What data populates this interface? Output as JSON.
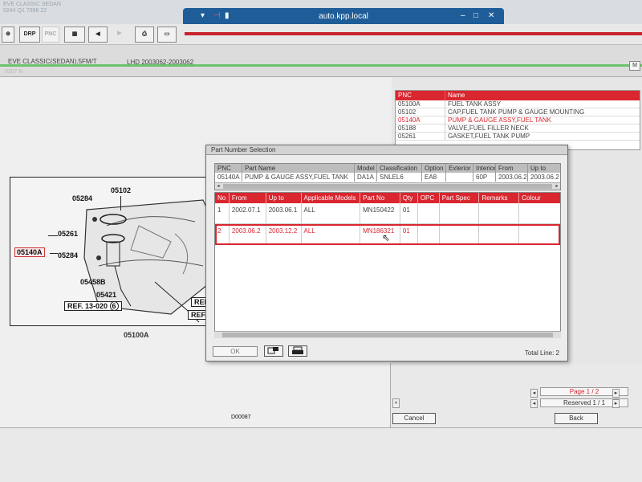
{
  "window": {
    "title": "auto.kpp.local",
    "controls": [
      "–",
      "□",
      "✕"
    ]
  },
  "topbar": {
    "ghost_text": [
      "EVE CLASSIC SEDAN",
      "0244 Q1 7998 22"
    ]
  },
  "toolbar": {
    "drp_label": "DRP",
    "pnc_label": "PNC"
  },
  "info": {
    "model": "EVE CLASSIC(SEDAN).5FM/T",
    "lhd": "LHD   2003062-2003062",
    "code": "0207 N",
    "right_box": "M"
  },
  "diagram": {
    "labels": {
      "c05102": "05102",
      "c05284a": "05284",
      "c05261": "05261",
      "c05140a": "05140A",
      "c05284b": "05284",
      "c05458b": "05458B",
      "c05421": "05421",
      "ref1": "REF. 13-020",
      "ref1_num": "6",
      "ref2": "REF",
      "ref3": "REF.",
      "c05100a": "05100A"
    },
    "figure_no": "D00087"
  },
  "pnc_list": {
    "headers": [
      "PNC",
      "Name"
    ],
    "rows": [
      {
        "pnc": "05100A",
        "name": "FUEL TANK ASSY",
        "selected": false
      },
      {
        "pnc": "05102",
        "name": "CAP,FUEL TANK PUMP & GAUGE MOUNTING",
        "selected": false
      },
      {
        "pnc": "05140A",
        "name": "PUMP & GAUGE ASSY,FUEL TANK",
        "selected": true
      },
      {
        "pnc": "05188",
        "name": "VALVE,FUEL FILLER NECK",
        "selected": false
      },
      {
        "pnc": "05261",
        "name": "GASKET,FUEL TANK PUMP",
        "selected": false
      }
    ]
  },
  "dialog": {
    "title": "Part Number Selection",
    "top_table": {
      "headers": [
        "PNC",
        "Part Name",
        "Model",
        "Classification",
        "Option",
        "Exterior",
        "Interior",
        "From",
        "Up to"
      ],
      "row": [
        "05140A",
        "PUMP & GAUGE ASSY,FUEL TANK",
        "DA1A",
        "SNLEL6",
        "EA8",
        "",
        "60P",
        "2003.06.2",
        "2003.06.2"
      ]
    },
    "main_table": {
      "headers": [
        "No",
        "From",
        "Up to",
        "Applicable Models",
        "Part No",
        "Qty",
        "OPC",
        "Part Spec",
        "Remarks",
        "Colour"
      ],
      "rows": [
        {
          "no": "1",
          "from": "2002.07.1",
          "upto": "2003.06.1",
          "models": "ALL",
          "part_no": "MN150422",
          "qty": "01",
          "opc": "",
          "spec": "",
          "remarks": "",
          "colour": ""
        },
        {
          "no": "2",
          "from": "2003.06.2",
          "upto": "2003.12.2",
          "models": "ALL",
          "part_no": "MN186321",
          "qty": "01",
          "opc": "",
          "spec": "",
          "remarks": "",
          "colour": ""
        }
      ]
    },
    "ok_label": "OK",
    "total": "Total Line: 2"
  },
  "right_panel": {
    "page": "Page 1 / 2",
    "reserved": "Reserved 1 / 1",
    "cancel_label": "Cancel",
    "back_label": "Back"
  },
  "colors": {
    "accent_red": "#d9262f",
    "window_blue": "#1f5d98",
    "green_strip": "#6cc36c"
  }
}
